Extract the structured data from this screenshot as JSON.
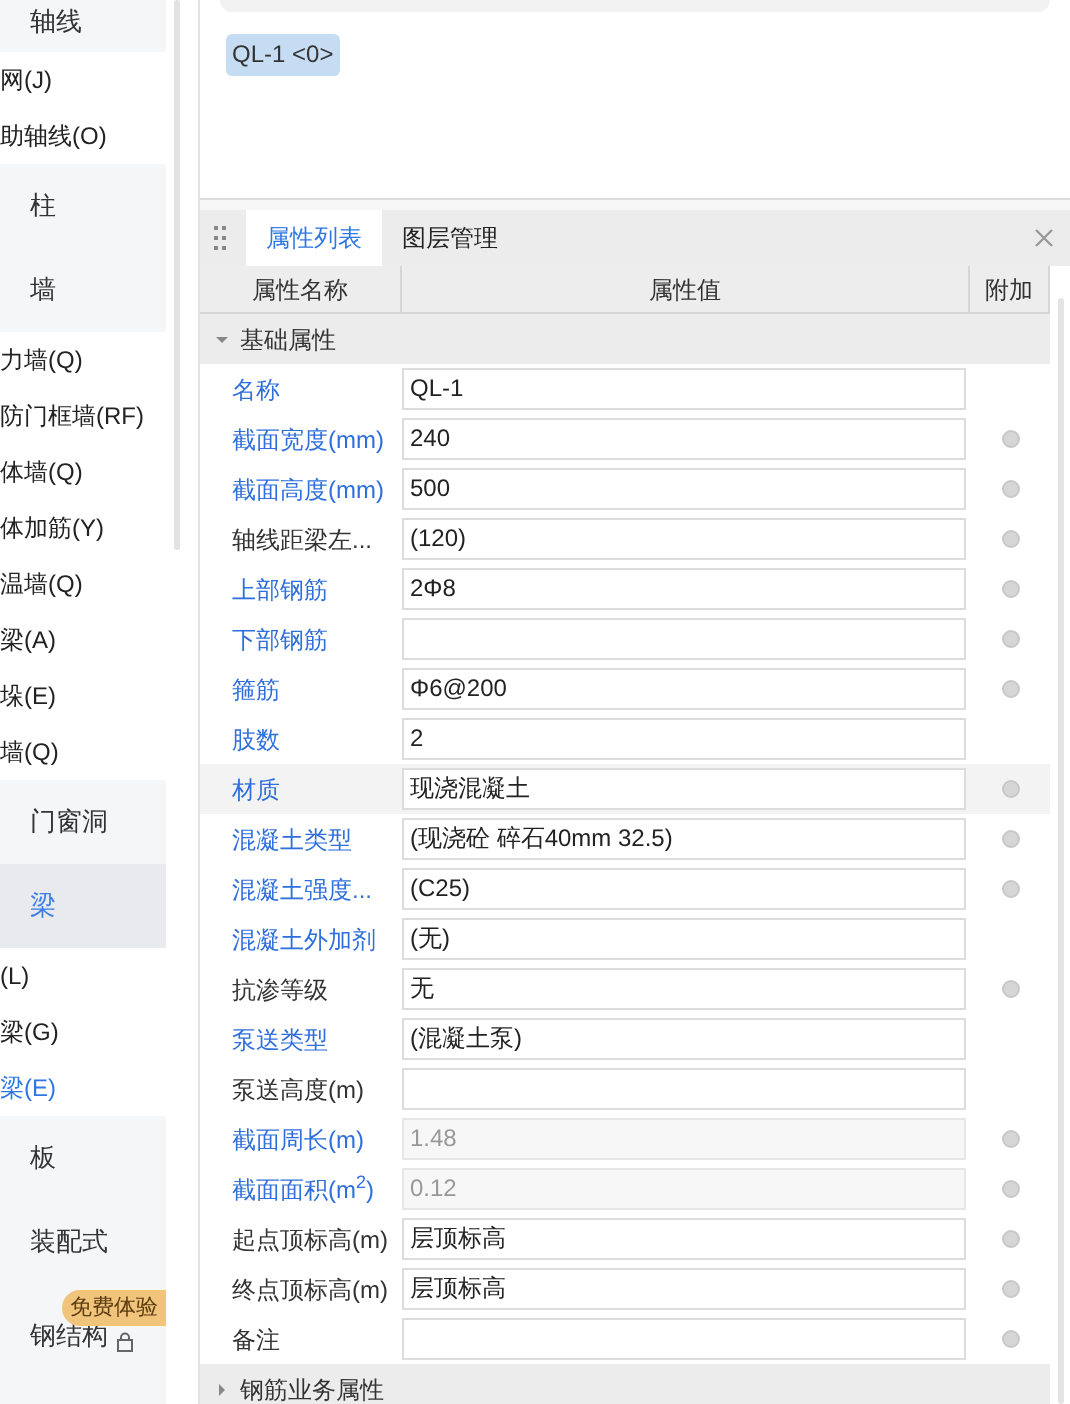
{
  "sidebar": [
    {
      "kind": "category",
      "label": "轴线",
      "selected": false
    },
    {
      "kind": "item",
      "label": "网(J)",
      "selected": false
    },
    {
      "kind": "item",
      "label": "助轴线(O)",
      "selected": false
    },
    {
      "kind": "category",
      "label": "柱",
      "selected": false
    },
    {
      "kind": "category",
      "label": "墙",
      "selected": false
    },
    {
      "kind": "item",
      "label": "力墙(Q)",
      "selected": false
    },
    {
      "kind": "item",
      "label": "防门框墙(RF)",
      "selected": false
    },
    {
      "kind": "item",
      "label": "体墙(Q)",
      "selected": false
    },
    {
      "kind": "item",
      "label": "体加筋(Y)",
      "selected": false
    },
    {
      "kind": "item",
      "label": "温墙(Q)",
      "selected": false
    },
    {
      "kind": "item",
      "label": "梁(A)",
      "selected": false
    },
    {
      "kind": "item",
      "label": "垛(E)",
      "selected": false
    },
    {
      "kind": "item",
      "label": "墙(Q)",
      "selected": false
    },
    {
      "kind": "category",
      "label": "门窗洞",
      "selected": false
    },
    {
      "kind": "category",
      "label": "梁",
      "selected": true
    },
    {
      "kind": "item",
      "label": "(L)",
      "selected": false
    },
    {
      "kind": "item",
      "label": "梁(G)",
      "selected": false
    },
    {
      "kind": "item",
      "label": "梁(E)",
      "selected": true
    },
    {
      "kind": "category",
      "label": "板",
      "selected": false
    },
    {
      "kind": "category",
      "label": "装配式",
      "selected": false
    },
    {
      "kind": "category",
      "label": "钢结构",
      "selected": false,
      "badge": "免费体验",
      "locked": true
    }
  ],
  "tag": "QL-1 <0>",
  "tabs": [
    {
      "label": "属性列表",
      "selected": true
    },
    {
      "label": "图层管理",
      "selected": false
    }
  ],
  "columns": [
    "属性名称",
    "属性值",
    "附加"
  ],
  "groups": [
    {
      "label": "基础属性",
      "expanded": true,
      "rows": [
        {
          "name": "名称",
          "value": "QL-1",
          "linked": true,
          "attach": false,
          "selected": false
        },
        {
          "name": "截面宽度(mm)",
          "value": "240",
          "linked": true,
          "attach": true,
          "selected": false
        },
        {
          "name": "截面高度(mm)",
          "value": "500",
          "linked": true,
          "attach": true,
          "selected": false
        },
        {
          "name": "轴线距梁左...",
          "value": "(120)",
          "linked": false,
          "attach": true,
          "selected": false
        },
        {
          "name": "上部钢筋",
          "value": "2Φ8",
          "linked": true,
          "attach": true,
          "selected": false
        },
        {
          "name": "下部钢筋",
          "value": "",
          "linked": true,
          "attach": true,
          "selected": false
        },
        {
          "name": "箍筋",
          "value": "Φ6@200",
          "linked": true,
          "attach": true,
          "selected": false
        },
        {
          "name": "肢数",
          "value": "2",
          "linked": true,
          "attach": false,
          "selected": false
        },
        {
          "name": "材质",
          "value": "现浇混凝土",
          "linked": true,
          "attach": true,
          "selected": true
        },
        {
          "name": "混凝土类型",
          "value": "(现浇砼 碎石40mm 32.5)",
          "linked": true,
          "attach": true,
          "selected": false
        },
        {
          "name": "混凝土强度...",
          "value": "(C25)",
          "linked": true,
          "attach": true,
          "selected": false
        },
        {
          "name": "混凝土外加剂",
          "value": "(无)",
          "linked": true,
          "attach": false,
          "selected": false
        },
        {
          "name": "抗渗等级",
          "value": "无",
          "linked": false,
          "attach": true,
          "selected": false
        },
        {
          "name": "泵送类型",
          "value": "(混凝土泵)",
          "linked": true,
          "attach": false,
          "selected": false
        },
        {
          "name": "泵送高度(m)",
          "value": "",
          "linked": false,
          "attach": false,
          "selected": false
        },
        {
          "name": "截面周长(m)",
          "value": "1.48",
          "linked": true,
          "attach": true,
          "disabled": true,
          "selected": false
        },
        {
          "name": "截面面积(m$^{2}$)",
          "value": "0.12",
          "linked": true,
          "attach": true,
          "disabled": true,
          "selected": false
        },
        {
          "name": "起点顶标高(m)",
          "value": "层顶标高",
          "linked": false,
          "attach": true,
          "selected": false
        },
        {
          "name": "终点顶标高(m)",
          "value": "层顶标高",
          "linked": false,
          "attach": true,
          "selected": false
        },
        {
          "name": "备注",
          "value": "",
          "linked": false,
          "attach": true,
          "selected": false
        }
      ]
    },
    {
      "label": "钢筋业务属性",
      "expanded": false
    }
  ]
}
